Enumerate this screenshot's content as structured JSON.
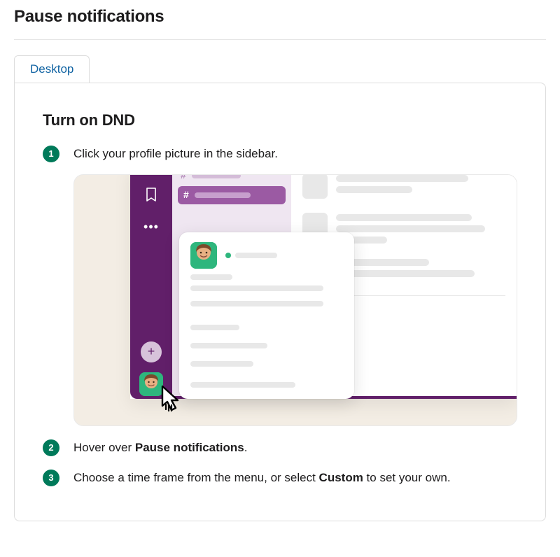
{
  "page": {
    "title": "Pause notifications"
  },
  "tabs": [
    {
      "label": "Desktop"
    }
  ],
  "section": {
    "title": "Turn on DND"
  },
  "steps": [
    {
      "text": "Click your profile picture in the sidebar."
    },
    {
      "prefix": "Hover over ",
      "bold": "Pause notifications",
      "suffix": "."
    },
    {
      "prefix": "Choose a time frame from the menu, or select ",
      "bold": "Custom",
      "suffix": " to set your own."
    }
  ]
}
